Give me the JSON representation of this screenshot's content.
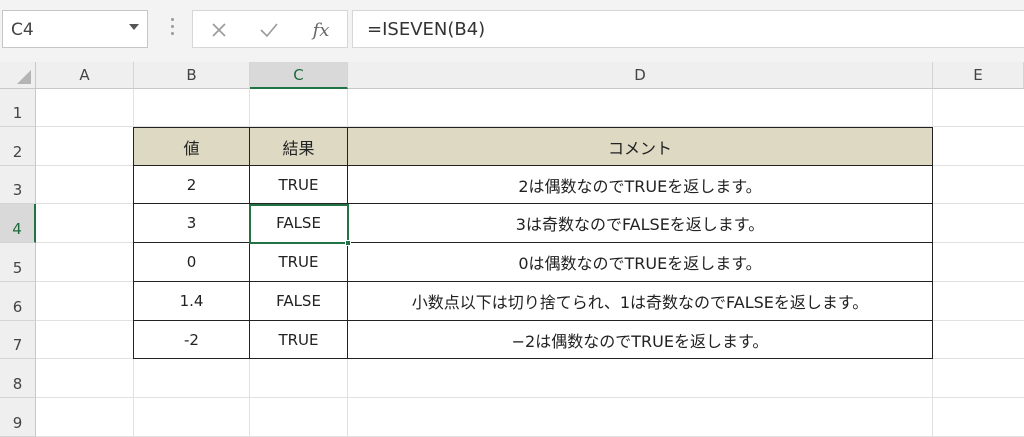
{
  "name_box": {
    "value": "C4"
  },
  "formula_bar": {
    "formula": "=ISEVEN(B4)",
    "cancel_icon": "close-icon",
    "enter_icon": "check-icon",
    "fx_label": "fx"
  },
  "columns": [
    "A",
    "B",
    "C",
    "D",
    "E"
  ],
  "selected_column": "C",
  "rows": [
    "1",
    "2",
    "3",
    "4",
    "5",
    "6",
    "7",
    "8",
    "9"
  ],
  "selected_row": "4",
  "table": {
    "headers": [
      "値",
      "結果",
      "コメント"
    ],
    "rows": [
      [
        "2",
        "TRUE",
        "2は偶数なのでTRUEを返します。"
      ],
      [
        "3",
        "FALSE",
        "3は奇数なのでFALSEを返します。"
      ],
      [
        "0",
        "TRUE",
        "0は偶数なのでTRUEを返します。"
      ],
      [
        "1.4",
        "FALSE",
        "小数点以下は切り捨てられ、1は奇数なのでFALSEを返します。"
      ],
      [
        "-2",
        "TRUE",
        "−2は偶数なのでTRUEを返します。"
      ]
    ]
  },
  "colors": {
    "header_fill": "#ddd9c3",
    "selection": "#217346"
  }
}
